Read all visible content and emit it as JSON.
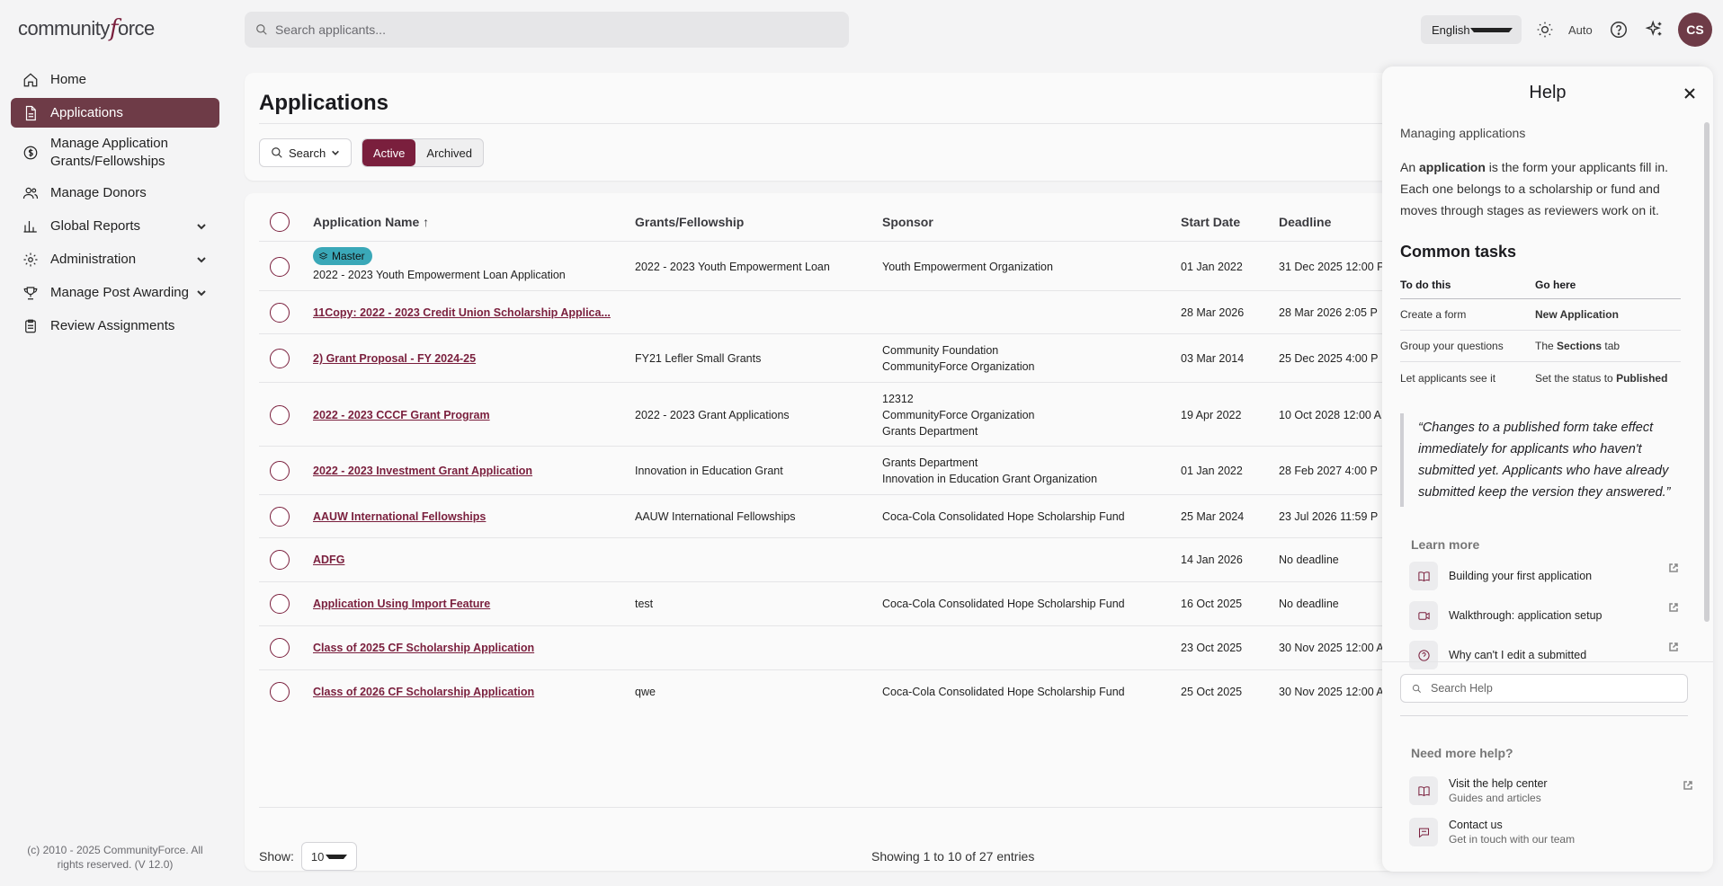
{
  "brand": {
    "logo_pre": "community",
    "logo_f": "f",
    "logo_post": "orce"
  },
  "sidebar": {
    "items": [
      {
        "label": "Home",
        "icon": "home-icon"
      },
      {
        "label": "Applications",
        "icon": "document-icon",
        "active": true
      },
      {
        "label": "Manage Application Grants/Fellowships",
        "icon": "dollar-circle-icon"
      },
      {
        "label": "Manage Donors",
        "icon": "users-icon"
      },
      {
        "label": "Global Reports",
        "icon": "bar-chart-icon",
        "expandable": true
      },
      {
        "label": "Administration",
        "icon": "gear-icon",
        "expandable": true
      },
      {
        "label": "Manage Post Awarding",
        "icon": "trophy-icon",
        "expandable": true
      },
      {
        "label": "Review Assignments",
        "icon": "clipboard-icon"
      }
    ],
    "copyright": "(c) 2010 - 2025 CommunityForce. All rights reserved. (V 12.0)"
  },
  "topbar": {
    "search_placeholder": "Search applicants...",
    "language": "English",
    "theme": "Auto",
    "avatar": "CS"
  },
  "page": {
    "title": "Applications",
    "search_button": "Search",
    "tabs": [
      "Active",
      "Archived"
    ],
    "active_tab": "Active"
  },
  "table": {
    "columns": [
      "Application Name ↑",
      "Grants/Fellowship",
      "Sponsor",
      "Start Date",
      "Deadline"
    ],
    "master_badge": "Master",
    "rows": [
      {
        "name": "2022 - 2023 Youth Empowerment Loan Application",
        "master": true,
        "grant": "2022 - 2023 Youth Empowerment Loan",
        "sponsor": [
          "Youth Empowerment Organization"
        ],
        "start": "01 Jan 2022",
        "deadline": "31 Dec 2025 12:00 P"
      },
      {
        "name": "11Copy: 2022 - 2023 Credit Union Scholarship Applica...",
        "grant": "",
        "sponsor": [],
        "start": "28 Mar 2026",
        "deadline": "28 Mar 2026 2:05 P"
      },
      {
        "name": "2) Grant Proposal - FY 2024-25",
        "grant": "FY21 Lefler Small Grants",
        "sponsor": [
          "Community Foundation",
          "CommunityForce Organization"
        ],
        "start": "03 Mar 2014",
        "deadline": "25 Dec 2025 4:00 P"
      },
      {
        "name": "2022 - 2023 CCCF Grant Program",
        "grant": "2022 - 2023 Grant Applications",
        "sponsor": [
          "12312",
          "CommunityForce Organization",
          "Grants Department"
        ],
        "start": "19 Apr 2022",
        "deadline": "10 Oct 2028 12:00 A"
      },
      {
        "name": "2022 - 2023 Investment Grant Application",
        "grant": "Innovation in Education Grant",
        "sponsor": [
          "Grants Department",
          "Innovation in Education Grant Organization"
        ],
        "start": "01 Jan 2022",
        "deadline": "28 Feb 2027 4:00 P"
      },
      {
        "name": "AAUW International Fellowships",
        "grant": "AAUW International Fellowships",
        "sponsor": [
          "Coca-Cola Consolidated Hope Scholarship Fund"
        ],
        "start": "25 Mar 2024",
        "deadline": "23 Jul 2026 11:59 P"
      },
      {
        "name": "ADFG",
        "grant": "",
        "sponsor": [],
        "start": "14 Jan 2026",
        "deadline": "No deadline"
      },
      {
        "name": "Application Using Import Feature",
        "grant": "test",
        "sponsor": [
          "Coca-Cola Consolidated Hope Scholarship Fund"
        ],
        "start": "16 Oct 2025",
        "deadline": "No deadline"
      },
      {
        "name": "Class of 2025 CF Scholarship Application",
        "grant": "",
        "sponsor": [],
        "start": "23 Oct 2025",
        "deadline": "30 Nov 2025 12:00 A"
      },
      {
        "name": "Class of 2026 CF Scholarship Application",
        "grant": "qwe",
        "sponsor": [
          "Coca-Cola Consolidated Hope Scholarship Fund"
        ],
        "start": "25 Oct 2025",
        "deadline": "30 Nov 2025 12:00 A"
      }
    ],
    "show_label": "Show:",
    "page_size": "10",
    "entries": "Showing 1 to 10 of 27 entries"
  },
  "help": {
    "title": "Help",
    "subtitle": "Managing applications",
    "intro_pre": "An ",
    "intro_bold": "application",
    "intro_post": " is the form your applicants fill in. Each one belongs to a scholarship or fund and moves through stages as reviewers work on it.",
    "tasks_heading": "Common tasks",
    "tasks_head": [
      "To do this",
      "Go here"
    ],
    "tasks": [
      {
        "task": "Create a form",
        "pre": "",
        "bold": "New Application",
        "post": ""
      },
      {
        "task": "Group your questions",
        "pre": "The ",
        "bold": "Sections",
        "post": " tab"
      },
      {
        "task": "Let applicants see it",
        "pre": "Set the status to ",
        "bold": "Published",
        "post": ""
      }
    ],
    "quote": "“Changes to a published form take effect immediately for applicants who haven't submitted yet. Applicants who have already submitted keep the version they answered.”",
    "learn_heading": "Learn more",
    "learn": [
      {
        "label": "Building your first application",
        "icon": "book-icon"
      },
      {
        "label": "Walkthrough: application setup",
        "icon": "video-icon"
      },
      {
        "label": "Why can't I edit a submitted",
        "icon": "question-icon"
      }
    ],
    "search_placeholder": "Search Help",
    "need_heading": "Need more help?",
    "need": [
      {
        "label": "Visit the help center",
        "sub": "Guides and articles",
        "icon": "book-icon"
      },
      {
        "label": "Contact us",
        "sub": "Get in touch with our team",
        "icon": "chat-icon"
      }
    ]
  }
}
